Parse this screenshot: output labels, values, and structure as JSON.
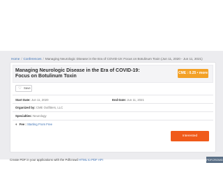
{
  "breadcrumb": {
    "home": "Home",
    "sep": "/",
    "conferences": "Conferences",
    "current": "Managing Neurologic Disease in the Era of COVID-19: Focus on Botulinum Toxin (Jun 11, 2020 - Jun 11, 2021)"
  },
  "event": {
    "title": "Managing Neurologic Disease in the Era of COVID-19: Focus on Botulinum Toxin",
    "cme_badge": "CME : 0.25  • more",
    "save_label": "Save",
    "start_date_label": "Start Date:",
    "start_date_value": "Jun 11, 2020",
    "end_date_label": "End Date:",
    "end_date_value": "Jun 11, 2021",
    "organized_by_label": "Organized by:",
    "organized_by_value": "CME Outfitters, LLC",
    "specialties_label": "Specialties:",
    "specialties_value": "Neurology",
    "fee_label": "Fee :",
    "fee_value": "Starting From Free",
    "interested_label": "Interested"
  },
  "footer": {
    "text": "Create PDF in your applications with the Pdfcrowd",
    "link": "HTML to PDF API",
    "logo": "PDFCROWD"
  },
  "colors": {
    "accent_orange": "#f05a1a",
    "badge_orange": "#f3a126",
    "link_blue": "#3a6fb3"
  },
  "icons": {
    "save": "heart-icon",
    "fee": "tag-icon"
  }
}
